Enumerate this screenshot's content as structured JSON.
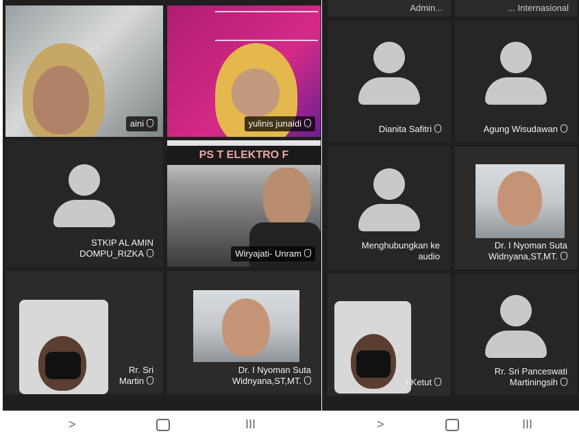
{
  "left_screen": {
    "tiles": [
      {
        "name": "aini"
      },
      {
        "name": "yulinis junaidi"
      },
      {
        "name": "STKIP AL AMIN\nDOMPU_RIZKA"
      },
      {
        "name": "Wiryajati- Unram",
        "banner": "PS T ELEKTRO F"
      },
      {
        "name": "Rr. Sri\nMartin"
      },
      {
        "name": "Dr. I Nyoman Suta\nWidnyana,ST,MT."
      }
    ]
  },
  "right_screen": {
    "top_strips": [
      {
        "text": "Admin..."
      },
      {
        "text": "... Internasional"
      }
    ],
    "tiles": [
      {
        "name": "Dianita Safitri"
      },
      {
        "name": "Agung Wisudawan"
      },
      {
        "name": "Menghubungkan ke\naudio"
      },
      {
        "name": "Dr. I Nyoman Suta\nWidnyana,ST,MT."
      },
      {
        "name": "I Ketut"
      },
      {
        "name": "Rr. Sri Panceswati\nMartiningsih"
      }
    ]
  },
  "navigation": {
    "back": ">",
    "home": "",
    "recents": "III"
  },
  "colors": {
    "tile_bg": "#2b2b2b",
    "avatar": "#c9c9c9",
    "badge_bg": "#000000"
  }
}
